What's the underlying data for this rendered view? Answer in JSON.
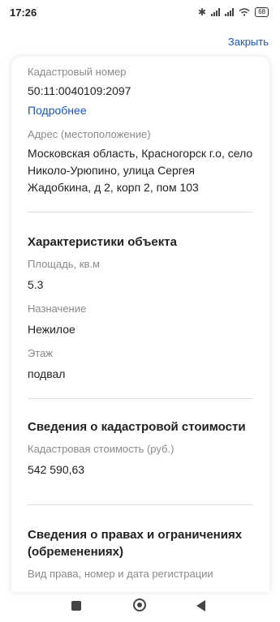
{
  "status_bar": {
    "time": "17:26",
    "battery": "68"
  },
  "header": {
    "close_label": "Закрыть"
  },
  "cadastral": {
    "number_label": "Кадастровый номер",
    "number_value": "50:11:0040109:2097",
    "more_link": "Подробнее",
    "address_label": "Адрес (местоположение)",
    "address_lines": [
      "Московская область, Красногорск г.о, село",
      "Николо-Урюпино, улица Сергея",
      "Жадобкина, д 2, корп 2, пом 103"
    ]
  },
  "characteristics": {
    "title": "Характеристики объекта",
    "area_label": "Площадь, кв.м",
    "area_value": "5.3",
    "purpose_label": "Назначение",
    "purpose_value": "Нежилое",
    "floor_label": "Этаж",
    "floor_value": "подвал"
  },
  "cost": {
    "title": "Сведения о кадастровой стоимости",
    "label": "Кадастровая стоимость (руб.)",
    "value": "542 590,63"
  },
  "rights": {
    "title_lines": [
      "Сведения о правах и ограничениях",
      "(обременениях)"
    ],
    "registration_label": "Вид права, номер и дата регистрации"
  }
}
